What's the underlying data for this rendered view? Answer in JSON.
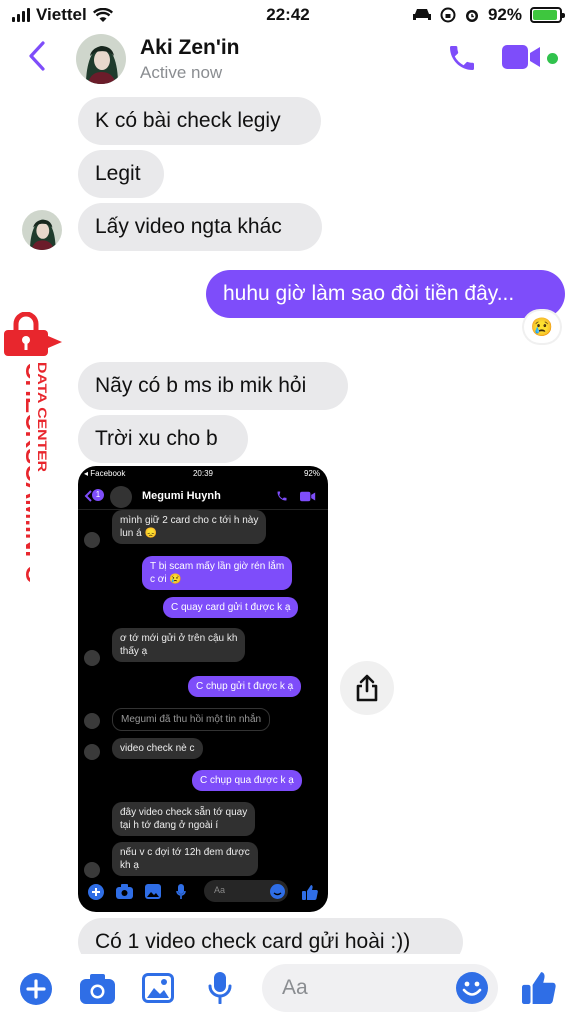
{
  "status_bar": {
    "carrier": "Viettel",
    "time": "22:42",
    "battery": "92%",
    "battery_level": 0.92
  },
  "header": {
    "contact_name": "Aki Zen'in",
    "contact_status": "Active now",
    "accent_color": "#7e4dfa",
    "online_color": "#31c24d"
  },
  "messages": {
    "m1": "K có bài check legiy",
    "m2": "Legit",
    "m3": "Lấy video ngta khác",
    "m4": "huhu giờ làm sao đòi tiền đây...",
    "m4_reaction": "😢",
    "m5": "Nãy có b ms ib mik hỏi",
    "m6": "Trời xu cho b",
    "m7": "Có 1 video check card gửi hoài :))"
  },
  "shared_screenshot": {
    "status_app": "◂ Facebook",
    "status_time": "20:39",
    "status_battery": "92%",
    "unread_count": "1",
    "contact_name": "Megumi Huynh",
    "lines": {
      "s1a": "mình giữ 2 card cho c tới h này",
      "s1b": "lun á 😞",
      "s2a": "T bị scam mấy lần giờ rén lắm",
      "s2b": "c ơi 😢",
      "s3": "C quay card gửi t được k ạ",
      "s4a": "ơ tớ mới gửi ở trên cậu kh",
      "s4b": "thấy ạ",
      "s5": "C chụp gửi t được k ạ",
      "s6": "Megumi đã thu hồi một tin nhắn",
      "s7": "video check nè c",
      "s8": "C chụp qua được k ạ",
      "s9a": "đây video check sẵn tớ quay",
      "s9b": "tại h tớ đang ở ngoài í",
      "s10a": "nếu v c đợi tớ 12h đem được",
      "s10b": "kh ạ"
    },
    "input_placeholder": "Aa"
  },
  "watermark": {
    "main": "CHECKSCAM.INFO",
    "sub": "DATA CENTER",
    "color": "#e8262d"
  },
  "composer": {
    "placeholder": "Aa",
    "icons": [
      "plus-icon",
      "camera-icon",
      "image-icon",
      "mic-icon",
      "emoji-icon",
      "thumbs-up-icon"
    ]
  }
}
